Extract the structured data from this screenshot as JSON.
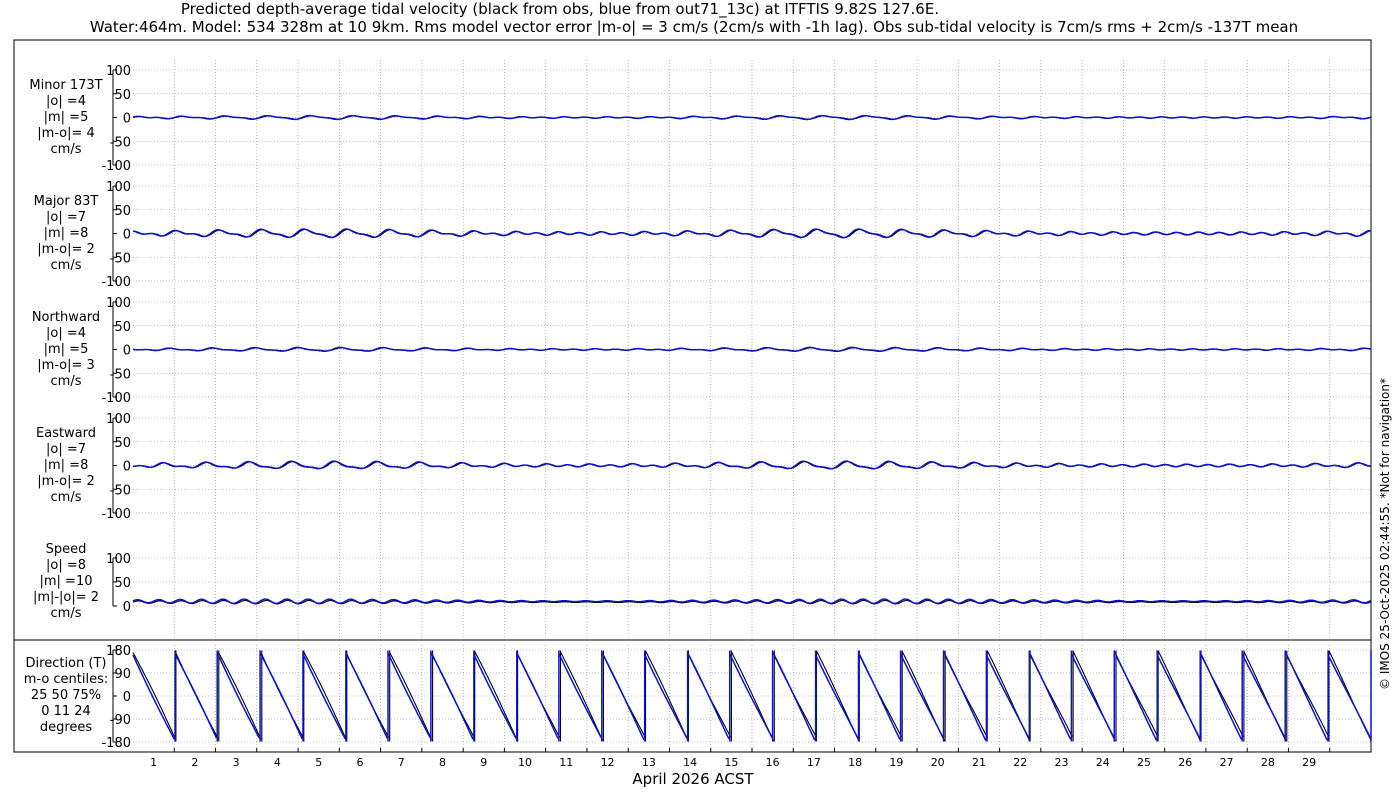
{
  "title_line1": "Predicted depth-average tidal velocity (black from obs, blue from out71_13c) at ITFTIS 9.82S 127.6E.",
  "title_line2": "Water:464m. Model: 534 328m at 10 9km. Rms model vector error |m-o| = 3 cm/s (2cm/s with -1h lag). Obs sub-tidal velocity is 7cm/s rms + 2cm/s -137T mean",
  "copyright": "© IMOS 25-Oct-2025 02:44:55. *Not for navigation*",
  "colors": {
    "obs": "#000000",
    "model": "#0a14c8",
    "grid": "#888888"
  },
  "chart_data": {
    "type": "line",
    "xlabel": "April 2026 ACST",
    "x_ticks": [
      "1",
      "2",
      "3",
      "4",
      "5",
      "6",
      "7",
      "8",
      "9",
      "10",
      "11",
      "12",
      "13",
      "14",
      "15",
      "16",
      "17",
      "18",
      "19",
      "20",
      "21",
      "22",
      "23",
      "24",
      "25",
      "26",
      "27",
      "28",
      "29"
    ],
    "x_range_days": [
      0,
      30
    ],
    "panels": [
      {
        "label": [
          "Minor 173T",
          "|o| =4",
          "|m| =5",
          "|m-o|= 4",
          "cm/s"
        ],
        "yticks": [
          "100",
          "50",
          "0",
          "-50",
          "-100"
        ],
        "ylim": [
          -100,
          100
        ],
        "series": [
          {
            "name": "obs",
            "amplitude": 4
          },
          {
            "name": "model",
            "amplitude": 5
          }
        ]
      },
      {
        "label": [
          "Major 83T",
          "|o| =7",
          "|m| =8",
          "|m-o|= 2",
          "cm/s"
        ],
        "yticks": [
          "100",
          "50",
          "0",
          "-50",
          "-100"
        ],
        "ylim": [
          -100,
          100
        ],
        "series": [
          {
            "name": "obs",
            "amplitude": 10
          },
          {
            "name": "model",
            "amplitude": 11
          }
        ]
      },
      {
        "label": [
          "Northward",
          "|o| =4",
          "|m| =5",
          "|m-o|= 3",
          "cm/s"
        ],
        "yticks": [
          "100",
          "50",
          "0",
          "-50",
          "-100"
        ],
        "ylim": [
          -100,
          100
        ],
        "series": [
          {
            "name": "obs",
            "amplitude": 4
          },
          {
            "name": "model",
            "amplitude": 5
          }
        ]
      },
      {
        "label": [
          "Eastward",
          "|o| =7",
          "|m| =8",
          "|m-o|= 2",
          "cm/s"
        ],
        "yticks": [
          "100",
          "50",
          "0",
          "-50",
          "-100"
        ],
        "ylim": [
          -100,
          100
        ],
        "series": [
          {
            "name": "obs",
            "amplitude": 9
          },
          {
            "name": "model",
            "amplitude": 10
          }
        ]
      },
      {
        "label": [
          "Speed",
          "|o| =8",
          "|m| =10",
          "|m|-|o|= 2",
          "cm/s"
        ],
        "yticks": [
          "100",
          "50",
          "0"
        ],
        "ylim": [
          0,
          100
        ],
        "series": [
          {
            "name": "obs",
            "mean": 8
          },
          {
            "name": "model",
            "mean": 10
          }
        ]
      },
      {
        "label": [
          "Direction (T)",
          "m-o centiles:",
          "25  50  75%",
          "0  11  24",
          "degrees"
        ],
        "yticks": [
          "180",
          "90",
          "0",
          "-90",
          "-180"
        ],
        "ylim": [
          -180,
          180
        ],
        "series": [
          {
            "name": "obs"
          },
          {
            "name": "model"
          }
        ]
      }
    ]
  }
}
